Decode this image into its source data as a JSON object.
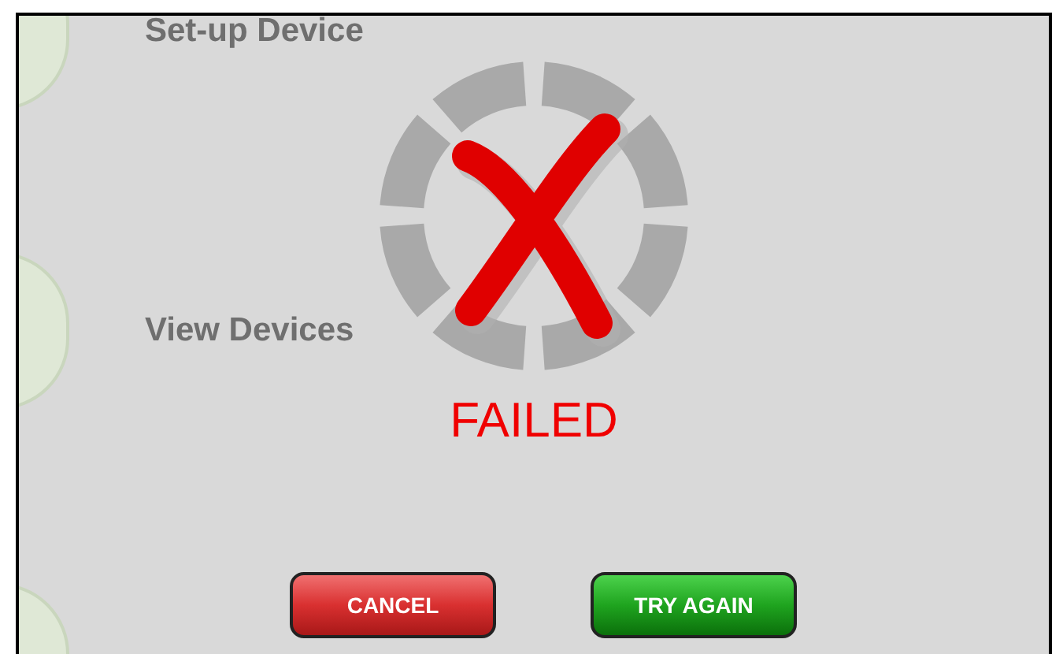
{
  "background_menu": [
    {
      "label": "Set-up Device"
    },
    {
      "label": "View Devices"
    }
  ],
  "status": {
    "kind": "failed",
    "text": "FAILED"
  },
  "buttons": [
    {
      "label": "CANCEL",
      "kind": "cancel"
    },
    {
      "label": "TRY AGAIN",
      "kind": "confirm"
    }
  ]
}
